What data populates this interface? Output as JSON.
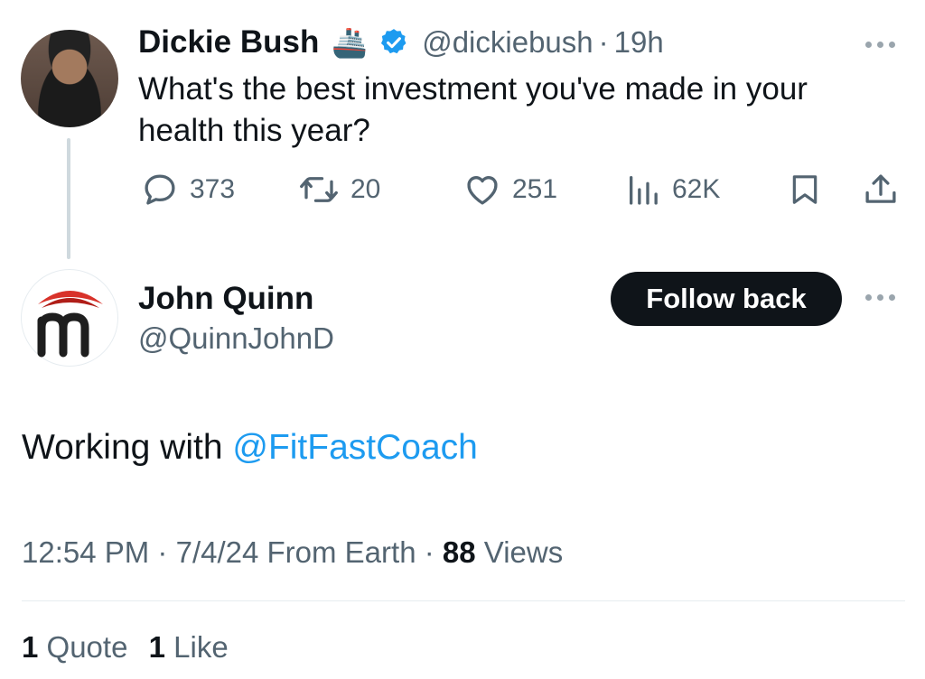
{
  "parent_tweet": {
    "author_name": "Dickie Bush",
    "author_emoji": "🚢",
    "author_handle": "@dickiebush",
    "separator": "·",
    "time_ago": "19h",
    "text_line1": "What's the best investment you've made in your",
    "text_line2": "health this year?",
    "replies": "373",
    "retweets": "20",
    "likes": "251",
    "views": "62K"
  },
  "reply": {
    "author_name": "John Quinn",
    "author_handle": "@QuinnJohnD",
    "follow_label": "Follow back",
    "text_prefix": "Working with ",
    "mention": "@FitFastCoach",
    "time": "12:54 PM",
    "dot1": "·",
    "date": "7/4/24",
    "source": "From Earth",
    "dot2": "·",
    "views_count": "88",
    "views_label": "Views",
    "quotes_count": "1",
    "quotes_label": "Quote",
    "likes_count": "1",
    "likes_label": "Like"
  },
  "colors": {
    "accent": "#1d9bf0",
    "muted": "#536471",
    "button": "#0f1419",
    "logo_red": "#d8322a"
  },
  "icons": [
    "reply-icon",
    "retweet-icon",
    "like-icon",
    "views-icon",
    "bookmark-icon",
    "share-icon",
    "verified-badge-icon",
    "more-icon"
  ]
}
